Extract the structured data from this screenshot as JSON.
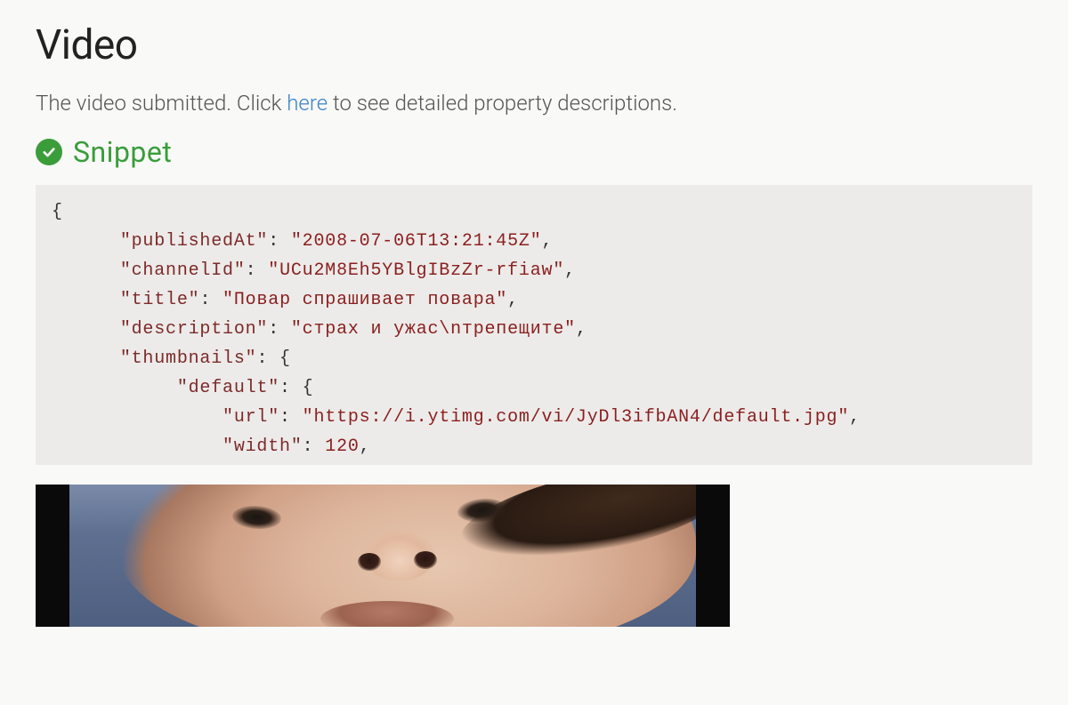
{
  "header": {
    "title": "Video",
    "intro_prefix": "The video submitted. Click ",
    "intro_link": "here",
    "intro_suffix": " to see detailed property descriptions."
  },
  "section": {
    "title": "Snippet",
    "check_icon": "check-circle-icon"
  },
  "snippet": {
    "publishedAt": "2008-07-06T13:21:45Z",
    "channelId": "UCu2M8Eh5YBlgIBzZr-rfiaw",
    "title": "Повар спрашивает повара",
    "description": "страх и ужас\\nтрепещите",
    "thumbnails_default_url": "https://i.ytimg.com/vi/JyDl3ifbAN4/default.jpg",
    "thumbnails_default_width": "120"
  },
  "code_keys": {
    "publishedAt": "\"publishedAt\"",
    "channelId": "\"channelId\"",
    "title": "\"title\"",
    "description": "\"description\"",
    "thumbnails": "\"thumbnails\"",
    "default": "\"default\"",
    "url": "\"url\"",
    "width": "\"width\""
  }
}
